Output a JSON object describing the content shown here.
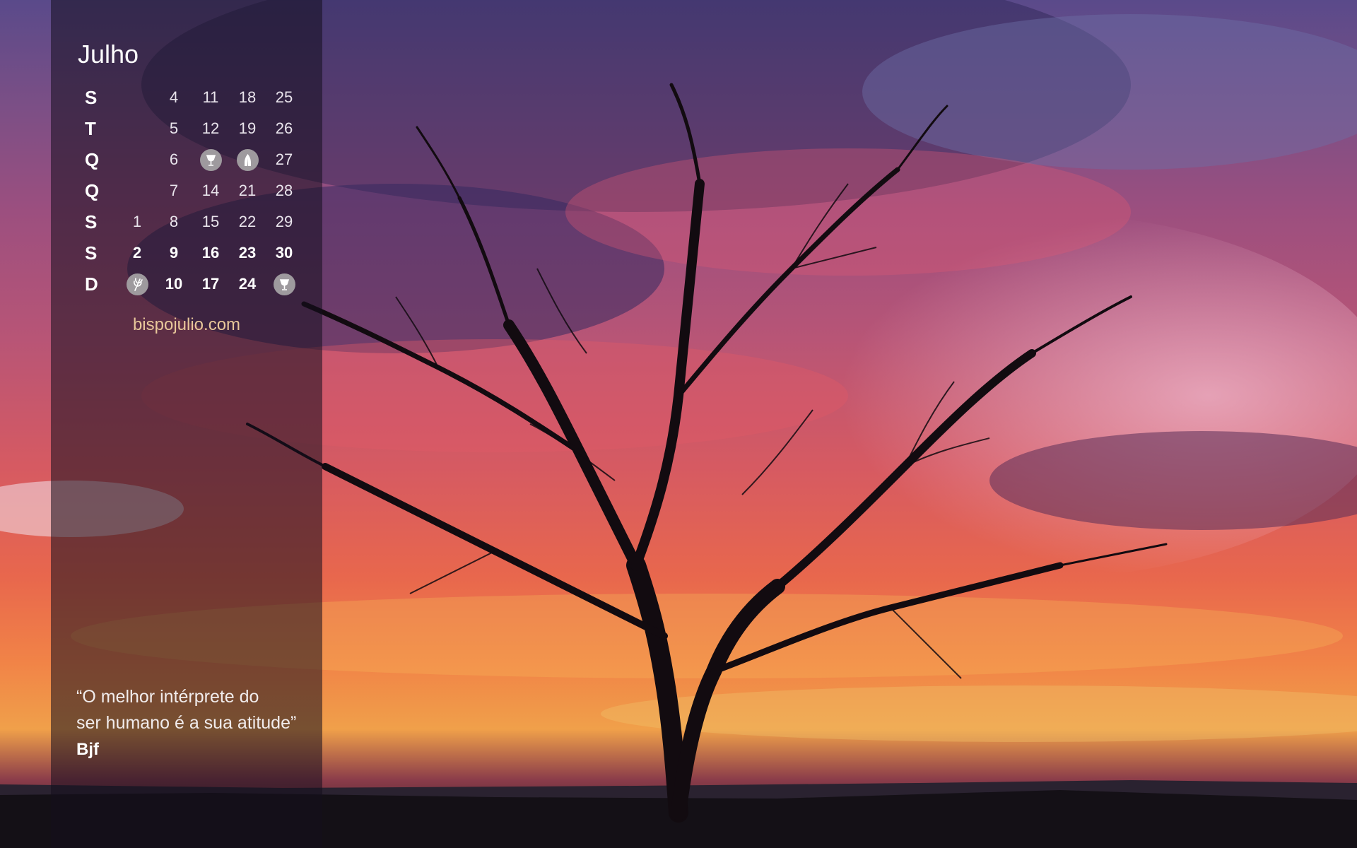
{
  "calendar": {
    "month": "Julho",
    "rows": [
      {
        "weekday": "S",
        "days": [
          "",
          "4",
          "11",
          "18",
          "25"
        ]
      },
      {
        "weekday": "T",
        "days": [
          "",
          "5",
          "12",
          "19",
          "26"
        ]
      },
      {
        "weekday": "Q",
        "days": [
          "",
          "6",
          "icon:chalice-icon",
          "icon:praying-hands-icon",
          "27"
        ]
      },
      {
        "weekday": "Q",
        "days": [
          "",
          "7",
          "14",
          "21",
          "28"
        ]
      },
      {
        "weekday": "S",
        "days": [
          "1",
          "8",
          "15",
          "22",
          "29"
        ]
      },
      {
        "weekday": "S",
        "days": [
          "2",
          "9",
          "16",
          "23",
          "30"
        ],
        "bold": true
      },
      {
        "weekday": "D",
        "days": [
          "icon:wheat-icon",
          "10",
          "17",
          "24",
          "icon:chalice-icon"
        ],
        "bold": true
      }
    ]
  },
  "website": "bispojulio.com",
  "quote": {
    "line1": "“O melhor intérprete do",
    "line2": "ser humano é a sua atitude”",
    "author": "Bjf"
  },
  "colors": {
    "panel": "#140e1e",
    "link": "#e8c79a",
    "icon_disc": "#9e9a9e"
  }
}
